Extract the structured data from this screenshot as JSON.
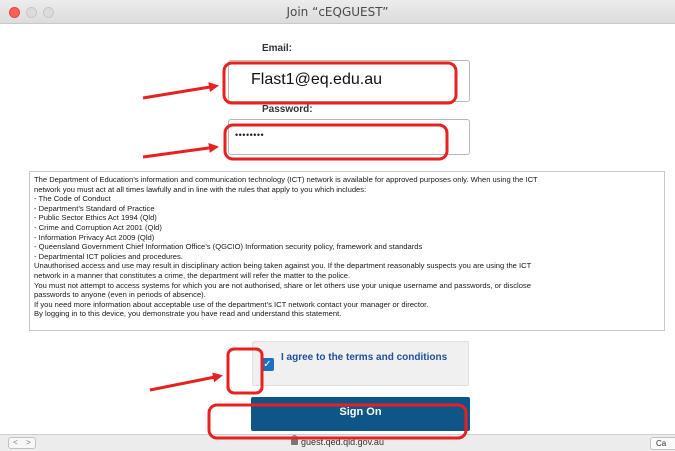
{
  "window": {
    "title": "Join “cEQGUEST”"
  },
  "form": {
    "email_label": "Email:",
    "email_value": "Flast1@eq.edu.au",
    "password_label": "Password:",
    "password_value": "••••••••"
  },
  "terms": {
    "lines": [
      "The Department of Education’s information and communication technology (ICT) network is available for approved purposes only. When using the ICT",
      "network you must act at all times lawfully and in line with the rules that apply to you which includes:",
      "- The Code of Conduct",
      "- Department’s Standard of Practice",
      "- Public Sector Ethics Act 1994 (Qld)",
      "- Crime and Corruption Act 2001 (Qld)",
      "- Information Privacy Act 2009 (Qld)",
      "- Queensland Government Chief Information Office’s (QGCIO) Information security policy, framework and standards",
      "- Departmental ICT policies and procedures.",
      "Unauthorised access and use may result in disciplinary action being taken against you. If the department reasonably suspects you are using the ICT",
      "network in a manner that constitutes a crime, the department will refer the matter to the police.",
      "You must not attempt to access systems for which you are not authorised, share or let others use your unique username and passwords, or disclose",
      "passwords to anyone (even in periods of absence).",
      "If you need more information about acceptable use of the department’s ICT network contact your manager or director.",
      "By logging in to this device, you demonstrate you have read and understand this statement."
    ]
  },
  "agree": {
    "label": "I agree to the terms and conditions",
    "checked": true
  },
  "buttons": {
    "sign_on": "Sign On",
    "cancel": "Ca"
  },
  "bottom_bar": {
    "url": "guest.qed.qld.gov.au",
    "back": "<",
    "forward": ">"
  },
  "colors": {
    "sign_on_bg": "#0d5687",
    "checkbox": "#1d6fc0",
    "annotation": "#e8201f"
  }
}
